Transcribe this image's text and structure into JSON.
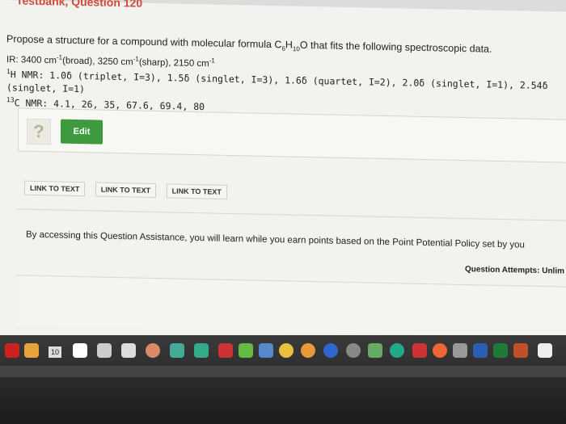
{
  "header": {
    "title": "Testbank, Question 120"
  },
  "question": {
    "prompt_prefix": "Propose a structure for a compound with molecular formula ",
    "formula": {
      "C": "C",
      "c_sub": "6",
      "H": "H",
      "h_sub": "10",
      "O": "O"
    },
    "prompt_suffix": " that fits the following spectroscopic data.",
    "ir_prefix": "IR: 3400 cm",
    "ir_sup1": "-1",
    "ir_mid1": "(broad), 3250 cm",
    "ir_sup2": "-1",
    "ir_mid2": "(sharp), 2150 cm",
    "ir_sup3": "-1",
    "hnmr_sup": "1",
    "hnmr_text": "H NMR: 1.0δ (triplet, I=3), 1.5δ (singlet, I=3), 1.6δ (quartet, I=2), 2.0δ (singlet, I=1), 2.54δ (singlet, I=1)",
    "cnmr_sup": "13",
    "cnmr_text": "C NMR: 4.1, 26, 35, 67.6, 69.4, 80"
  },
  "answer": {
    "qmark": "?",
    "edit_label": "Edit"
  },
  "links": [
    "LINK TO TEXT",
    "LINK TO TEXT",
    "LINK TO TEXT"
  ],
  "assist_text": "By accessing this Question Assistance, you will learn while you earn points based on the Point Potential Policy set by you",
  "attempts_text": "Question Attempts: Unlim",
  "dock": {
    "badge": "10"
  },
  "colors": {
    "edit_green": "#3f9a3f",
    "header_red": "#d04a3a"
  }
}
